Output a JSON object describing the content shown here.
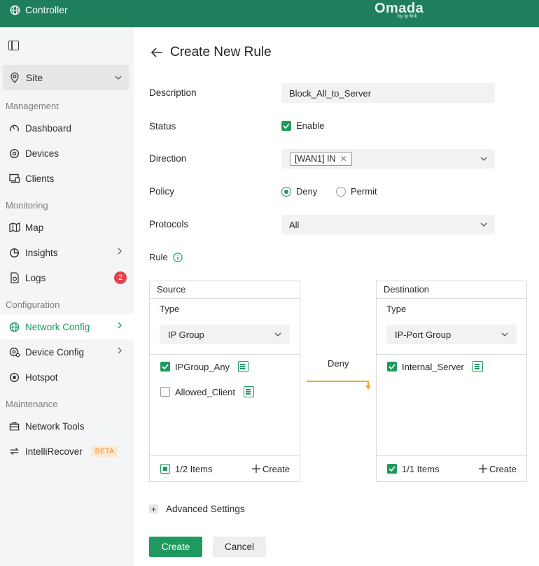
{
  "topbar": {
    "app_title": "Controller",
    "brand": "Omada",
    "brand_sub": "by tp-link"
  },
  "sidebar": {
    "site": "Site",
    "sections": {
      "management": "Management",
      "monitoring": "Monitoring",
      "configuration": "Configuration",
      "maintenance": "Maintenance"
    },
    "items": {
      "dashboard": "Dashboard",
      "devices": "Devices",
      "clients": "Clients",
      "map": "Map",
      "insights": "Insights",
      "logs": "Logs",
      "logs_badge": "2",
      "network_config": "Network Config",
      "device_config": "Device Config",
      "hotspot": "Hotspot",
      "network_tools": "Network Tools",
      "intellirecover": "IntelliRecover",
      "beta": "BETA"
    },
    "active_item": "Network Config"
  },
  "page": {
    "title": "Create New Rule",
    "labels": {
      "description": "Description",
      "status": "Status",
      "direction": "Direction",
      "policy": "Policy",
      "protocols": "Protocols",
      "rule": "Rule"
    },
    "description_value": "Block_All_to_Server",
    "status_enable": "Enable",
    "direction_tag": "[WAN1] IN",
    "policy_options": [
      "Deny",
      "Permit"
    ],
    "policy_selected": "Deny",
    "protocols_value": "All",
    "source": {
      "title": "Source",
      "type_label": "Type",
      "type_value": "IP Group",
      "items": [
        {
          "name": "IPGroup_Any",
          "checked": true
        },
        {
          "name": "Allowed_Client",
          "checked": false
        }
      ],
      "count": "1/2 Items",
      "create": "Create"
    },
    "flow_label": "Deny",
    "destination": {
      "title": "Destination",
      "type_label": "Type",
      "type_value": "IP-Port Group",
      "items": [
        {
          "name": "Internal_Server",
          "checked": true
        }
      ],
      "count": "1/1 Items",
      "create": "Create"
    },
    "advanced": "Advanced Settings",
    "buttons": {
      "create": "Create",
      "cancel": "Cancel"
    }
  },
  "colors": {
    "brand": "#1f7f5c",
    "accent": "#1f9a5f",
    "arrow": "#f0a733",
    "badge": "#e8404a"
  }
}
